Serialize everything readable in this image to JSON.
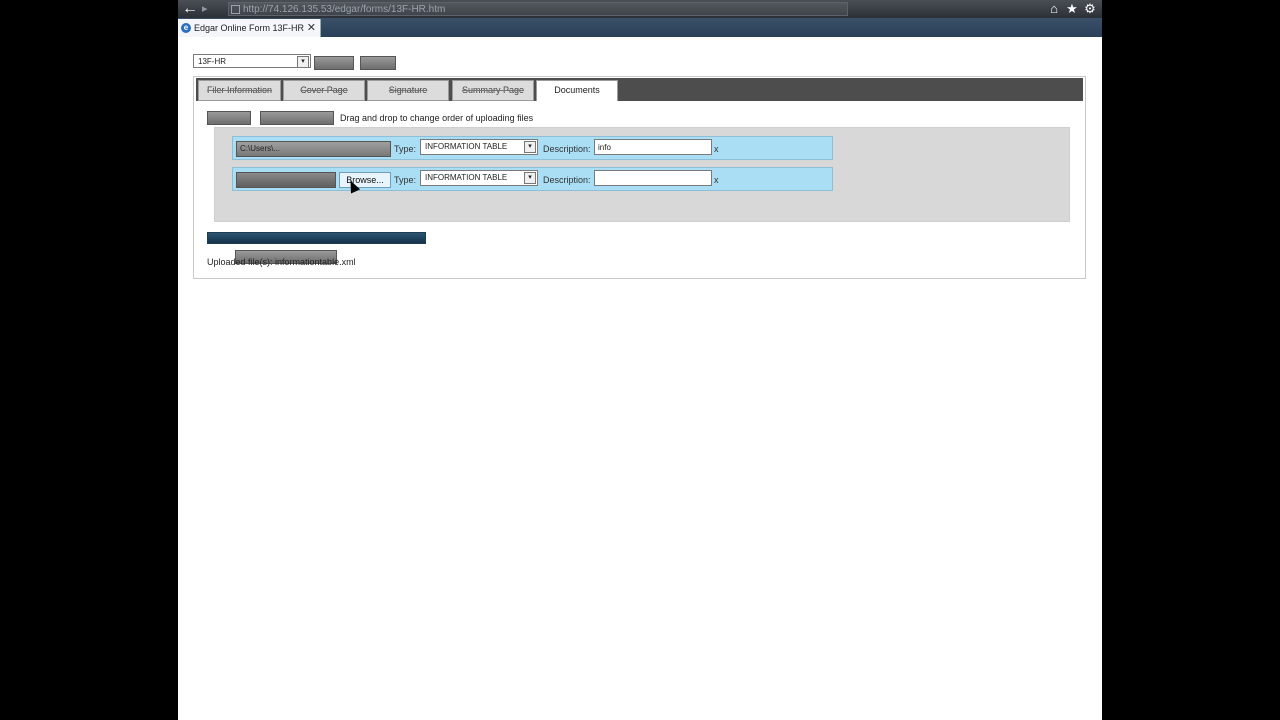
{
  "browser": {
    "url": "http://74.126.135.53/edgar/forms/13F-HR.htm",
    "tab_title": "Edgar Online Form 13F-HR",
    "tab_close": "✕",
    "back_glyph": "←",
    "forward_glyph": "▸",
    "icons": [
      "home-icon",
      "star-icon",
      "gear-icon"
    ]
  },
  "toolbar": {
    "form_select": "13F-HR",
    "select_arrow": "▾",
    "button_1": "",
    "button_2": ""
  },
  "tabs": [
    {
      "label": "Filer Information",
      "active": false
    },
    {
      "label": "Cover Page",
      "active": false
    },
    {
      "label": "Signature",
      "active": false
    },
    {
      "label": "Summary Page",
      "active": false
    },
    {
      "label": "Documents",
      "active": true
    }
  ],
  "documents": {
    "add_button": "",
    "remove_button": "",
    "hint": "Drag and drop to change order of uploading files",
    "type_label": "Type:",
    "desc_label": "Description:",
    "rows": [
      {
        "file": "C:\\Users\\...",
        "type": "INFORMATION TABLE",
        "description": "info",
        "remove": "x"
      },
      {
        "file": "",
        "browse": "Browse...",
        "type": "INFORMATION TABLE",
        "description": "",
        "remove": "x"
      }
    ],
    "upload_more": "",
    "progress": 100,
    "uploaded_files": "Uploaded file(s): informationtable.xml"
  },
  "colors": {
    "row_bg": "#a9def5",
    "progress": "#1e3c52",
    "tab_strip": "#4d4d4d"
  }
}
